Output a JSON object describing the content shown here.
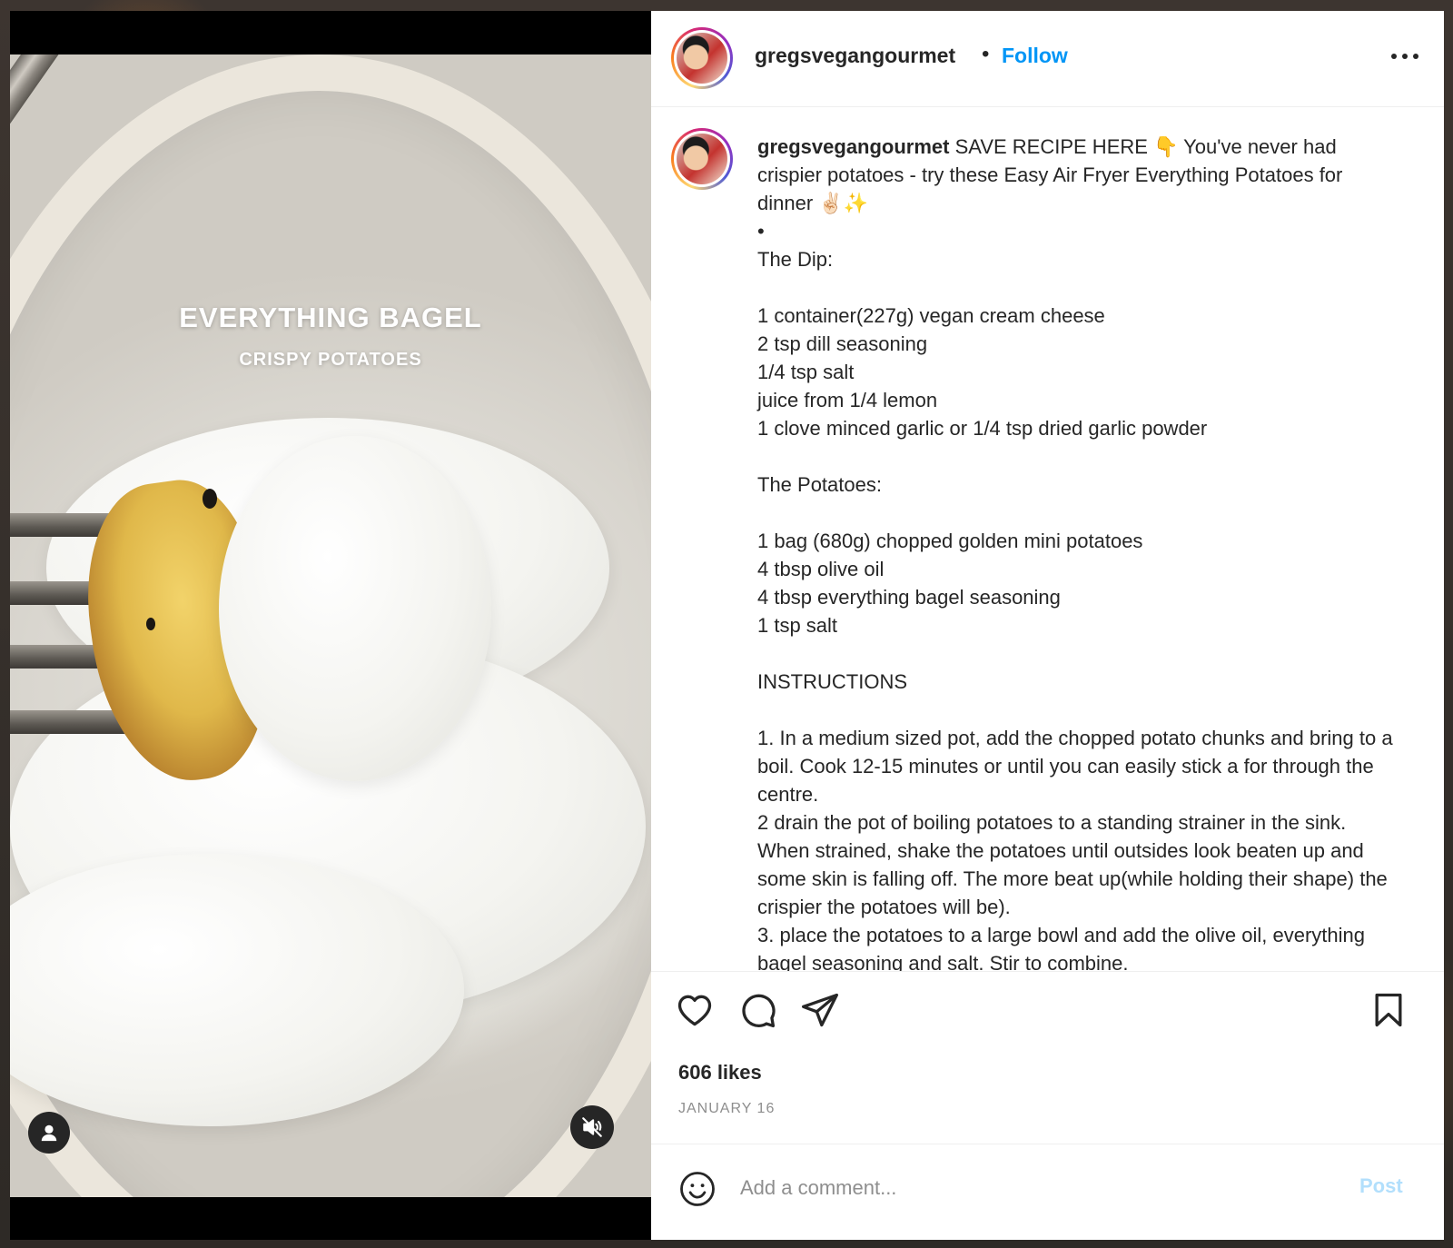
{
  "media": {
    "overlay_title": "EVERYTHING BAGEL",
    "overlay_subtitle": "CRISPY POTATOES"
  },
  "header": {
    "username": "gregsvegangourmet",
    "separator": "•",
    "follow_label": "Follow"
  },
  "caption": {
    "username": "gregsvegangourmet",
    "text": " SAVE RECIPE HERE 👇 You've never had crispier potatoes - try these Easy Air Fryer Everything Potatoes for dinner ✌🏻✨\n•\nThe Dip:\n\n1 container(227g) vegan cream cheese\n2 tsp dill seasoning\n1/4 tsp salt\njuice from 1/4 lemon\n1 clove minced garlic or 1/4 tsp dried garlic powder\n\nThe Potatoes:\n\n1 bag (680g) chopped golden mini potatoes\n4 tbsp olive oil\n4 tbsp everything bagel seasoning\n1 tsp salt\n\nINSTRUCTIONS\n\n1. In a medium sized pot, add the chopped potato chunks and bring to a boil. Cook 12-15 minutes or until you can easily stick a for through the centre.\n2 drain the pot of boiling potatoes to a standing strainer in the sink. When strained, shake the potatoes until outsides look beaten up and some skin is falling off. The more beat up(while holding their shape) the crispier the potatoes will be).\n3. place the potatoes to a large bowl and add the olive oil, everything bagel seasoning and salt. Stir to combine."
  },
  "stats": {
    "likes": "606 likes",
    "date": "JANUARY 16"
  },
  "comment": {
    "placeholder": "Add a comment...",
    "post_label": "Post"
  },
  "icons": {
    "like": "heart-icon",
    "comment": "comment-icon",
    "share": "send-icon",
    "save": "bookmark-icon",
    "emoji": "smiley-icon",
    "more": "more-icon",
    "user": "user-icon",
    "mute": "muted-speaker-icon"
  },
  "colors": {
    "follow_blue": "#0095f6",
    "post_disabled": "#b2dffc",
    "text": "#262626",
    "muted_text": "#8e8e8e"
  }
}
